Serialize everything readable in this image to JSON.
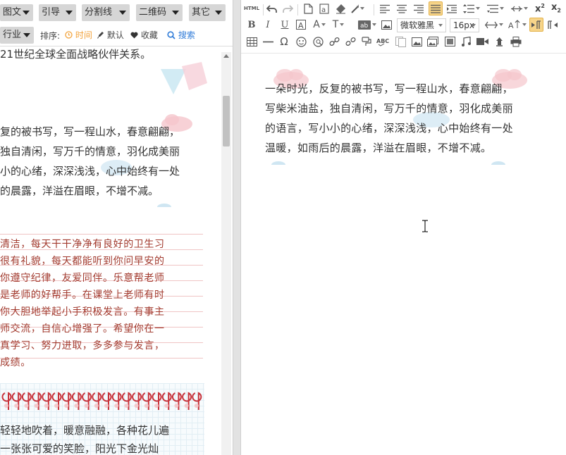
{
  "left_panel": {
    "category_row1": [
      "图文",
      "引导",
      "分割线",
      "二维码",
      "其它"
    ],
    "category_row2": [
      "行业"
    ],
    "sort": {
      "label": "排序:",
      "options": [
        {
          "icon": "clock-icon",
          "label": "时间",
          "active": true
        },
        {
          "icon": "pin-icon",
          "label": "默认",
          "active": false
        },
        {
          "icon": "heart-icon",
          "label": "收藏",
          "active": false
        }
      ],
      "search_label": "搜索"
    },
    "snippets": {
      "top_cut": "21世纪全球全面战略伙伴关系。",
      "poem_lines": [
        "复的被书写，写一程山水，春意翩翩，",
        "独自清闲，写万千的情意，羽化成美丽",
        "小的心绪，深深浅浅，心中始终有一处",
        "的晨露，洋溢在眉眼，不增不减。"
      ],
      "red_lines": [
        "清洁，每天干干净净有良好的卫生习",
        "很有礼貌，每天都能听到你问早安的",
        "你遵守纪律，友爱同伴。乐意帮老师",
        "是老师的好帮手。在课堂上老师有时",
        "你大胆地举起小手积极发言。有事主",
        "师交流，自信心增强了。希望你在一",
        "真学习、努力进取，多多参与发言，",
        "成绩。"
      ],
      "bottom_lines": [
        "轻轻地吹着，暖意融融，各种花儿遍",
        "一张张可爱的笑脸，阳光下金光灿"
      ]
    }
  },
  "toolbar": {
    "font_family": "微软雅黑",
    "font_size": "16px",
    "html_label": "HTML",
    "row1_icons": [
      "html-icon",
      "undo-icon",
      "redo-icon",
      "new-doc-icon",
      "format-icon",
      "clear-format-icon",
      "magic-icon",
      "align-left-icon",
      "align-center-icon",
      "align-right-icon",
      "justify-icon",
      "indent-icon",
      "line-height-icon",
      "paragraph-spacing-icon",
      "list-ordered-icon",
      "superscript-icon",
      "subscript-icon"
    ],
    "row2_icons": [
      "bold-icon",
      "italic-icon",
      "underline-icon",
      "font-border-icon",
      "font-color-icon",
      "text-shadow-icon",
      "background-color-icon",
      "image-icon",
      "font-family-select",
      "font-size-select",
      "spacing-icon",
      "case-icon",
      "rtl-icon"
    ],
    "row3_icons": [
      "table-icon",
      "horizontal-rule-icon",
      "omega-icon",
      "emotion-icon",
      "map-icon",
      "link-icon",
      "unlink-icon",
      "brush-icon",
      "spellcheck-icon",
      "template-icon",
      "picture-icon",
      "gallery-icon",
      "insert-image-icon",
      "music-icon",
      "video-icon",
      "attachment-icon",
      "print-icon"
    ]
  },
  "editor": {
    "article_lines": [
      "一朵时光，反复的被书写，写一程山水，春意翩翩，",
      "写柴米油盐，独自清闲，写万千的情意，羽化成美丽",
      "的语言，写小小的心绪，深深浅浅，心中始终有一处",
      "温暖，如雨后的晨露，洋溢在眉眼，不增不减。"
    ]
  },
  "colors": {
    "accent_orange": "#f2a23a",
    "search_blue": "#2f7bd8",
    "red_text": "#a23a2e",
    "active_tool": "#f7d58a"
  }
}
